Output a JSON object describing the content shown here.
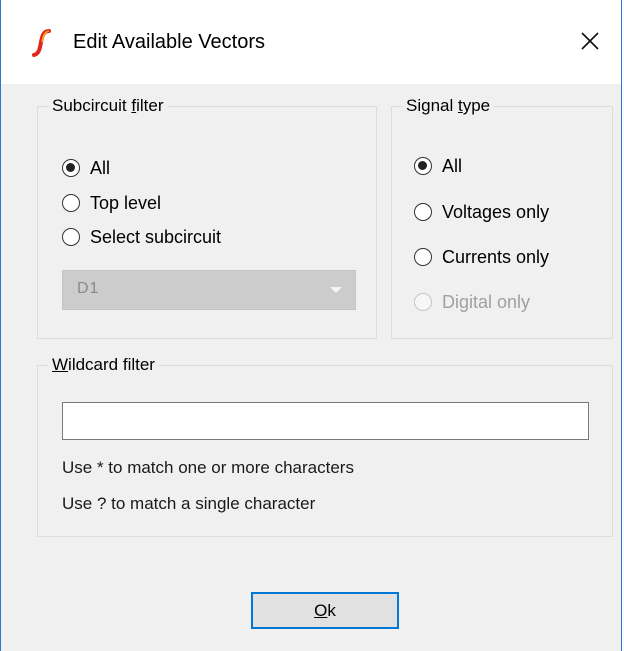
{
  "window": {
    "title": "Edit Available Vectors",
    "accent_color": "#2b79d6",
    "icon": "simetrix-logo-icon",
    "close_icon": "close-icon"
  },
  "subcircuit_filter": {
    "legend_pre": "Subcircuit ",
    "legend_ul": "f",
    "legend_post": "ilter",
    "options": [
      {
        "label": "All",
        "checked": true
      },
      {
        "label": "Top level",
        "checked": false
      },
      {
        "label": "Select subcircuit",
        "checked": false
      }
    ],
    "dropdown": {
      "value": "D1",
      "disabled": true,
      "icon": "chevron-down-icon"
    }
  },
  "signal_type": {
    "legend_pre": "Signal ",
    "legend_ul": "t",
    "legend_post": "ype",
    "options": [
      {
        "label": "All",
        "checked": true,
        "disabled": false
      },
      {
        "label": "Voltages only",
        "checked": false,
        "disabled": false
      },
      {
        "label": "Currents only",
        "checked": false,
        "disabled": false
      },
      {
        "label": "Digital only",
        "checked": false,
        "disabled": true
      }
    ]
  },
  "wildcard_filter": {
    "legend_ul": "W",
    "legend_post": "ildcard filter",
    "value": "",
    "hint1": "Use * to match one or more characters",
    "hint2": "Use ? to match a single character"
  },
  "ok_button": {
    "ul": "O",
    "rest": "k",
    "focus_color": "#0078d7"
  }
}
